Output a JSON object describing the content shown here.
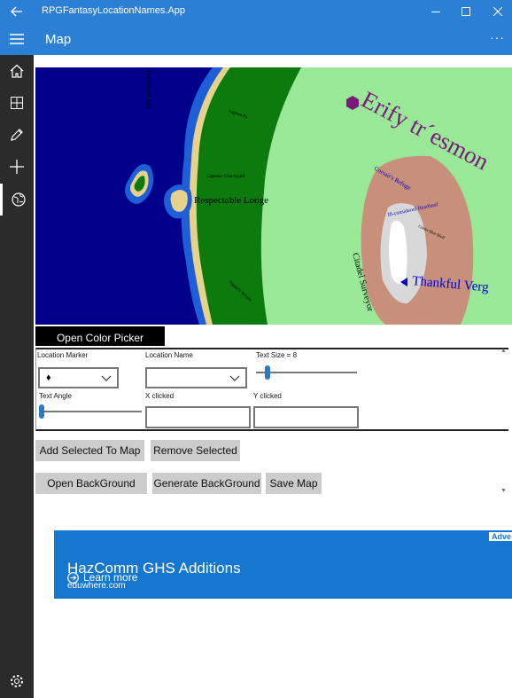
{
  "window": {
    "title": "RPGFantasyLocationNames.App",
    "back_icon": "arrow-left-icon",
    "controls": [
      "minimize-icon",
      "maximize-icon",
      "close-icon"
    ]
  },
  "header": {
    "title": "Map",
    "more": "···"
  },
  "nav": {
    "items": [
      "home-icon",
      "grid-icon",
      "pencil-icon",
      "add-icon",
      "globe-icon"
    ],
    "selected": "globe-icon",
    "settings": "gear-icon"
  },
  "map": {
    "labels": {
      "top_rotated": "Torrential fall",
      "erify": "Erify tr´esmon",
      "respectable": "Respectable Lodge",
      "thankful": "Thankful Verg",
      "citadel": "Citadel Surveyor",
      "corsair": "Corsair's Refuge",
      "headland": "Ill-considered Headland",
      "lagoon": "Lagoon Pit",
      "churchyard": "Ligneous Churchyard",
      "dipper": "Dipper's Terrace",
      "bluff": "Cinder Blue Bluff"
    },
    "colors": {
      "ocean": "#00008b",
      "shallow": "#1e5fd8",
      "sand": "#e6d28c",
      "forest": "#0c7a0c",
      "meadow": "#98e898",
      "desert": "#c8907a",
      "mountain": "#d8d8d8",
      "snow": "#ffffff",
      "marker": "#7a1b7a",
      "blue_label": "#0000cc"
    }
  },
  "color_picker": {
    "label": "Open Color Picker"
  },
  "controls": {
    "location_marker": {
      "label": "Location Marker",
      "value": "♦"
    },
    "location_name": {
      "label": "Location Name",
      "value": ""
    },
    "text_size": {
      "label": "Text Size = 8",
      "value": 8
    },
    "text_angle": {
      "label": "Text Angle",
      "value": 0
    },
    "x_clicked": {
      "label": "X clicked",
      "value": ""
    },
    "y_clicked": {
      "label": "Y clicked",
      "value": ""
    }
  },
  "buttons": {
    "add": "Add Selected To Map",
    "remove": "Remove Selected",
    "open_background": "Open BackGround",
    "generate_background": "Generate BackGround",
    "save_map": "Save Map"
  },
  "ad": {
    "tag": "Adve",
    "headline": "HazComm GHS Additions",
    "learn_more": "Learn more",
    "domain": "eduwhere.com",
    "color": "#1577cf"
  }
}
